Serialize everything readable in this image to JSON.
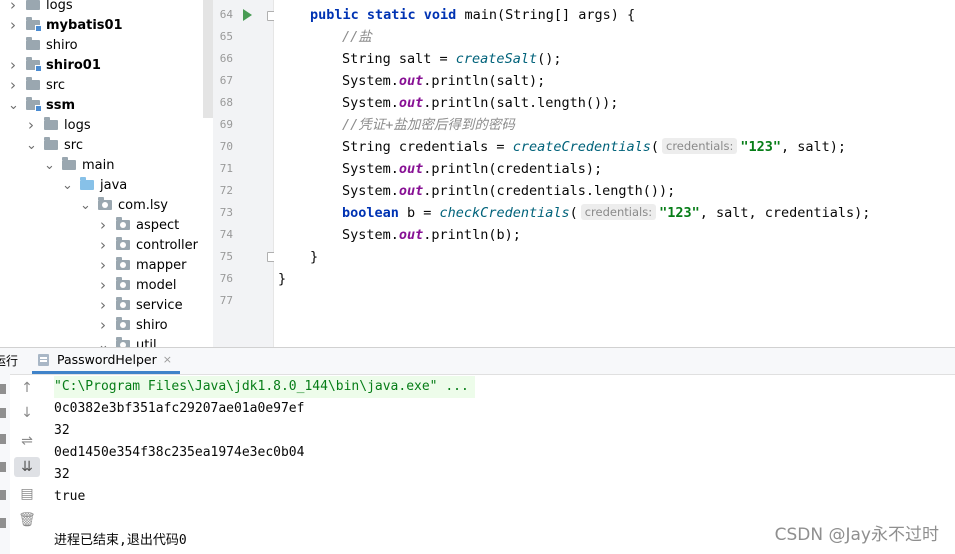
{
  "project_tree": {
    "items": [
      {
        "label": "logs",
        "chev": ">",
        "indent": 0,
        "bold": false,
        "kind": "folder"
      },
      {
        "label": "mybatis01",
        "chev": ">",
        "indent": 0,
        "bold": true,
        "kind": "module"
      },
      {
        "label": "shiro",
        "chev": "",
        "indent": 0,
        "bold": false,
        "kind": "folder"
      },
      {
        "label": "shiro01",
        "chev": ">",
        "indent": 0,
        "bold": true,
        "kind": "module"
      },
      {
        "label": "src",
        "chev": ">",
        "indent": 0,
        "bold": false,
        "kind": "folder"
      },
      {
        "label": "ssm",
        "chev": "v",
        "indent": 0,
        "bold": true,
        "kind": "module"
      },
      {
        "label": "logs",
        "chev": ">",
        "indent": 1,
        "bold": false,
        "kind": "folder"
      },
      {
        "label": "src",
        "chev": "v",
        "indent": 1,
        "bold": false,
        "kind": "folder"
      },
      {
        "label": "main",
        "chev": "v",
        "indent": 2,
        "bold": false,
        "kind": "folder"
      },
      {
        "label": "java",
        "chev": "v",
        "indent": 3,
        "bold": false,
        "kind": "java"
      },
      {
        "label": "com.lsy",
        "chev": "v",
        "indent": 4,
        "bold": false,
        "kind": "pkg"
      },
      {
        "label": "aspect",
        "chev": ">",
        "indent": 5,
        "bold": false,
        "kind": "pkg"
      },
      {
        "label": "controller",
        "chev": ">",
        "indent": 5,
        "bold": false,
        "kind": "pkg"
      },
      {
        "label": "mapper",
        "chev": ">",
        "indent": 5,
        "bold": false,
        "kind": "pkg"
      },
      {
        "label": "model",
        "chev": ">",
        "indent": 5,
        "bold": false,
        "kind": "pkg"
      },
      {
        "label": "service",
        "chev": ">",
        "indent": 5,
        "bold": false,
        "kind": "pkg"
      },
      {
        "label": "shiro",
        "chev": ">",
        "indent": 5,
        "bold": false,
        "kind": "pkg"
      },
      {
        "label": "util",
        "chev": "v",
        "indent": 5,
        "bold": false,
        "kind": "pkg"
      }
    ]
  },
  "editor": {
    "line_numbers": [
      "64",
      "65",
      "66",
      "67",
      "68",
      "69",
      "70",
      "71",
      "72",
      "73",
      "74",
      "75",
      "76",
      "77"
    ],
    "lines": [
      {
        "indent": 1,
        "tokens": [
          [
            "kw",
            "public static void "
          ],
          [
            "",
            "main(String[] args) {"
          ]
        ]
      },
      {
        "indent": 2,
        "tokens": [
          [
            "cm",
            "//盐"
          ]
        ]
      },
      {
        "indent": 2,
        "tokens": [
          [
            "",
            "String salt = "
          ],
          [
            "fn",
            "createSalt"
          ],
          [
            "",
            "();"
          ]
        ]
      },
      {
        "indent": 2,
        "tokens": [
          [
            "",
            "System."
          ],
          [
            "fld",
            "out"
          ],
          [
            "",
            ".println(salt);"
          ]
        ]
      },
      {
        "indent": 2,
        "tokens": [
          [
            "",
            "System."
          ],
          [
            "fld",
            "out"
          ],
          [
            "",
            ".println(salt.length());"
          ]
        ]
      },
      {
        "indent": 2,
        "tokens": [
          [
            "cm",
            "//凭证+盐加密后得到的密码"
          ]
        ]
      },
      {
        "indent": 2,
        "tokens": [
          [
            "",
            "String credentials = "
          ],
          [
            "fn",
            "createCredentials"
          ],
          [
            "",
            "("
          ],
          [
            "hint",
            "credentials:"
          ],
          [
            "st",
            "\"123\""
          ],
          [
            "",
            ", salt);"
          ]
        ]
      },
      {
        "indent": 2,
        "tokens": [
          [
            "",
            "System."
          ],
          [
            "fld",
            "out"
          ],
          [
            "",
            ".println(credentials);"
          ]
        ]
      },
      {
        "indent": 2,
        "tokens": [
          [
            "",
            "System."
          ],
          [
            "fld",
            "out"
          ],
          [
            "",
            ".println(credentials.length());"
          ]
        ]
      },
      {
        "indent": 2,
        "tokens": [
          [
            "kw",
            "boolean "
          ],
          [
            "",
            "b = "
          ],
          [
            "fn",
            "checkCredentials"
          ],
          [
            "",
            "("
          ],
          [
            "hint",
            "credentials:"
          ],
          [
            "st",
            "\"123\""
          ],
          [
            "",
            ", salt, credentials);"
          ]
        ]
      },
      {
        "indent": 2,
        "tokens": [
          [
            "",
            "System."
          ],
          [
            "fld",
            "out"
          ],
          [
            "",
            ".println(b);"
          ]
        ]
      },
      {
        "indent": 1,
        "tokens": [
          [
            "",
            "}"
          ]
        ]
      },
      {
        "indent": 0,
        "tokens": [
          [
            "",
            "}"
          ]
        ]
      },
      {
        "indent": 0,
        "tokens": []
      }
    ]
  },
  "run_panel": {
    "label": "运行:",
    "tab_label": "PasswordHelper",
    "tab_close": "×",
    "tools": [
      "↑",
      "↓",
      "⇌",
      "⇊",
      "▤",
      "🗑"
    ],
    "output": [
      {
        "text": "\"C:\\Program Files\\Java\\jdk1.8.0_144\\bin\\java.exe\" ...",
        "cmd": true
      },
      {
        "text": "0c0382e3bf351afc29207ae01a0e97ef",
        "cmd": false
      },
      {
        "text": "32",
        "cmd": false
      },
      {
        "text": "0ed1450e354f38c235ea1974e3ec0b04",
        "cmd": false
      },
      {
        "text": "32",
        "cmd": false
      },
      {
        "text": "true",
        "cmd": false
      },
      {
        "text": "",
        "cmd": false
      },
      {
        "text": "进程已结束,退出代码0",
        "cmd": false
      }
    ]
  },
  "watermark": "CSDN @Jay永不过时"
}
